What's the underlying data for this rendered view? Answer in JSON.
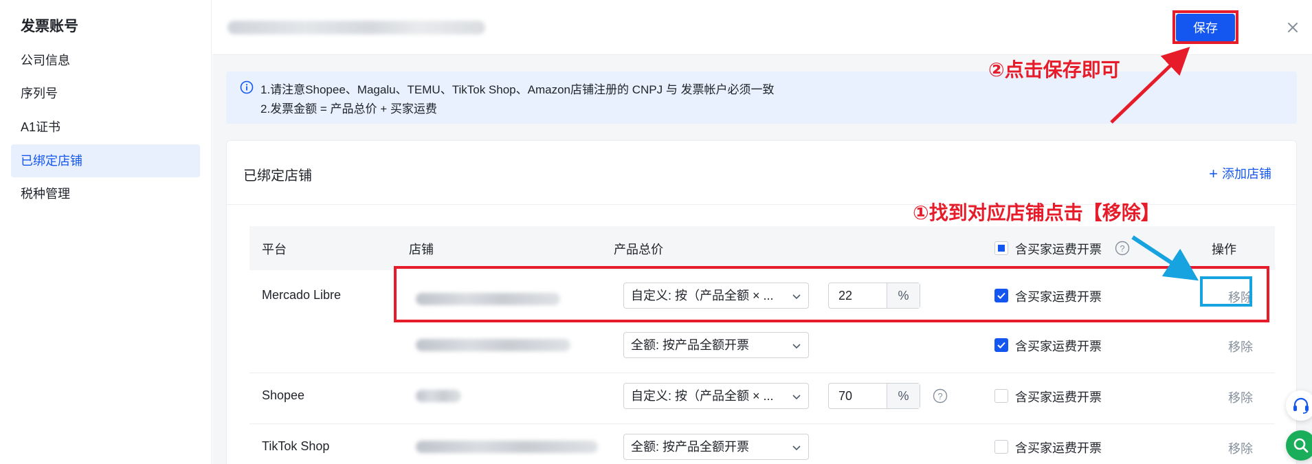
{
  "sidebar": {
    "title": "发票账号",
    "items": [
      {
        "label": "公司信息"
      },
      {
        "label": "序列号"
      },
      {
        "label": "A1证书"
      },
      {
        "label": "已绑定店铺"
      },
      {
        "label": "税种管理"
      }
    ],
    "active_index": 3
  },
  "header": {
    "save_label": "保存"
  },
  "notice": {
    "line1": "1.请注意Shopee、Magalu、TEMU、TikTok Shop、Amazon店铺注册的 CNPJ 与 发票帐户必须一致",
    "line2": "2.发票金额 = 产品总价 + 买家运费"
  },
  "card": {
    "title": "已绑定店铺",
    "add_label": "添加店铺"
  },
  "table": {
    "columns": {
      "platform": "平台",
      "store": "店铺",
      "price": "产品总价",
      "shipping": "含买家运费开票",
      "action": "操作"
    },
    "header_checkbox_state": "indeterminate",
    "rows": [
      {
        "platform": "Mercado Libre",
        "price_mode": "自定义: 按（产品全额 × ...",
        "percent": "22",
        "unit": "%",
        "shipping_checked": true,
        "shipping_label": "含买家运费开票",
        "action": "移除"
      },
      {
        "platform": "",
        "price_mode": "全额: 按产品全额开票",
        "shipping_checked": true,
        "shipping_label": "含买家运费开票",
        "action": "移除"
      },
      {
        "platform": "Shopee",
        "price_mode": "自定义: 按（产品全额 × ...",
        "percent": "70",
        "unit": "%",
        "shipping_checked": false,
        "shipping_label": "含买家运费开票",
        "action": "移除"
      },
      {
        "platform": "TikTok Shop",
        "price_mode": "全额: 按产品全额开票",
        "shipping_checked": false,
        "shipping_label": "含买家运费开票",
        "action": "移除"
      }
    ]
  },
  "annotations": {
    "step1": "①找到对应店铺点击【移除】",
    "step2": "②点击保存即可"
  },
  "colors": {
    "primary": "#1456f0",
    "annotation_red": "#e61c2a",
    "annotation_blue": "#16a3e0",
    "float_green": "#1aad5a"
  },
  "icons": [
    "close-icon",
    "info-icon",
    "plus-icon",
    "chevron-down-icon",
    "help-icon",
    "headset-icon",
    "search-icon"
  ]
}
